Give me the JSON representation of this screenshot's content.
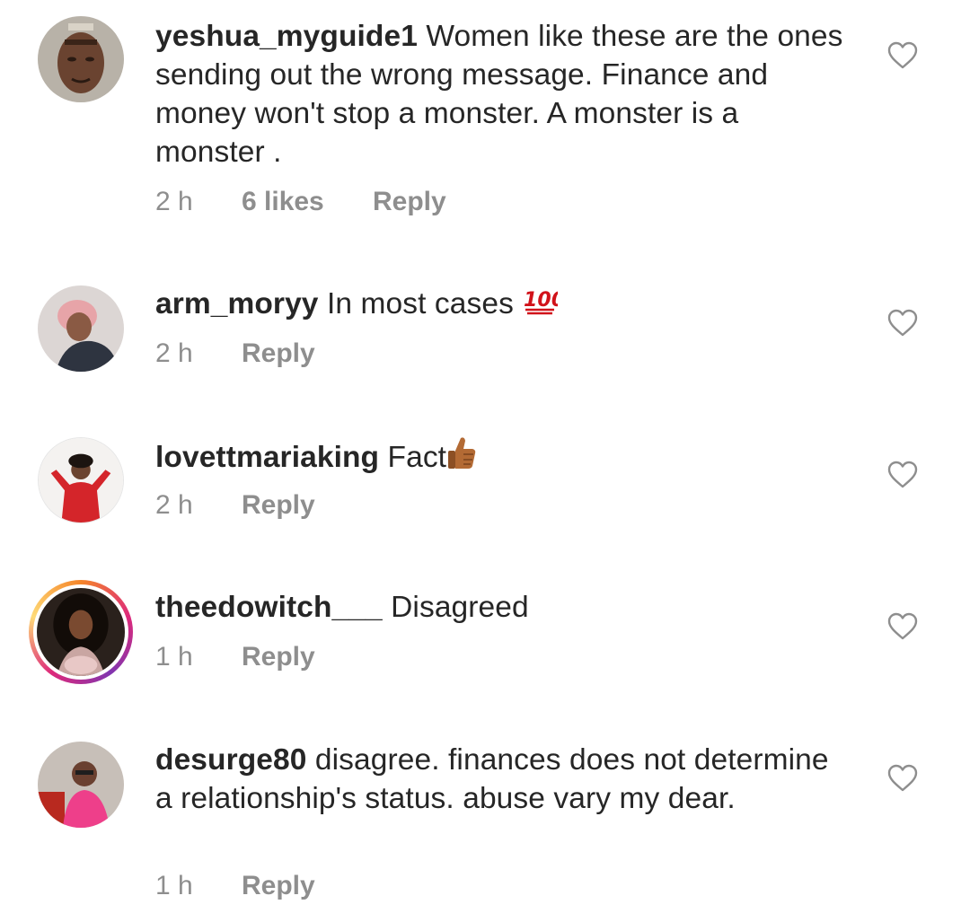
{
  "comments": [
    {
      "username": "yeshua_myguide1",
      "text": "Women like these are the ones sending out the wrong message. Finance and money won't stop a monster. A monster is a monster .",
      "time": "2 h",
      "likes": "6 likes",
      "reply": "Reply"
    },
    {
      "username": "arm_moryy",
      "text": "In most cases",
      "emoji": "hundred-points-icon",
      "time": "2 h",
      "reply": "Reply"
    },
    {
      "username": "lovettmariaking",
      "text": "Fact",
      "emoji": "thumbs-up-icon",
      "time": "2 h",
      "reply": "Reply"
    },
    {
      "username": "theedowitch___",
      "text": "Disagreed",
      "time": "1 h",
      "reply": "Reply",
      "has_story": true
    },
    {
      "username": "desurge80",
      "text": "disagree. finances does not determine a relationship's status. abuse vary my dear.",
      "time": "1 h",
      "reply": "Reply"
    }
  ],
  "colors": {
    "text": "#262626",
    "meta": "#8e8e8e",
    "heart_outline": "#8e8e8e",
    "story_ring": [
      "#f58529",
      "#dd2a7b",
      "#8134af"
    ]
  },
  "icons": {
    "like": "heart-outline-icon"
  }
}
